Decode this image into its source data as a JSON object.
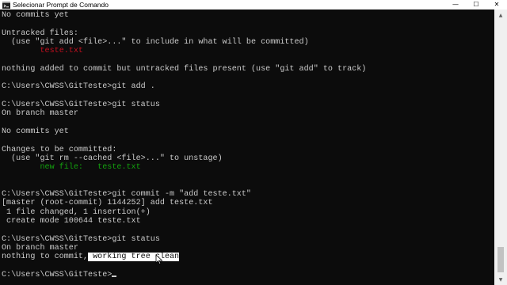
{
  "window": {
    "title": "Selecionar Prompt de Comando",
    "icon": "cmd-icon",
    "controls": {
      "minimize": "—",
      "maximize": "☐",
      "close": "✕"
    }
  },
  "scrollbar": {
    "up_glyph": "▲",
    "down_glyph": "▼"
  },
  "colors": {
    "background": "#0c0c0c",
    "text": "#cccccc",
    "red": "#c50f1f",
    "green": "#13a10e",
    "selection": "#ffffff"
  },
  "console": {
    "l00": "No commits yet",
    "l01": "",
    "l02": "Untracked files:",
    "l03": "  (use \"git add <file>...\" to include in what will be committed)",
    "l04_indent": "        ",
    "l04_file": "teste.txt",
    "l05": "",
    "l06": "nothing added to commit but untracked files present (use \"git add\" to track)",
    "l07": "",
    "l08": "C:\\Users\\CWSS\\GitTeste>git add .",
    "l09": "",
    "l10": "C:\\Users\\CWSS\\GitTeste>git status",
    "l11": "On branch master",
    "l12": "",
    "l13": "No commits yet",
    "l14": "",
    "l15": "Changes to be committed:",
    "l16": "  (use \"git rm --cached <file>...\" to unstage)",
    "l17_indent": "        ",
    "l17_label": "new file:   ",
    "l17_file": "teste.txt",
    "l18": "",
    "l19": "",
    "l20": "C:\\Users\\CWSS\\GitTeste>git commit -m \"add teste.txt\"",
    "l21": "[master (root-commit) 1144252] add teste.txt",
    "l22": " 1 file changed, 1 insertion(+)",
    "l23": " create mode 100644 teste.txt",
    "l24": "",
    "l25": "C:\\Users\\CWSS\\GitTeste>git status",
    "l26": "On branch master",
    "l27_a": "nothing to commit,",
    "l27_sel": " working tree clean",
    "l28": "",
    "l29_prompt": "C:\\Users\\CWSS\\GitTeste>"
  }
}
